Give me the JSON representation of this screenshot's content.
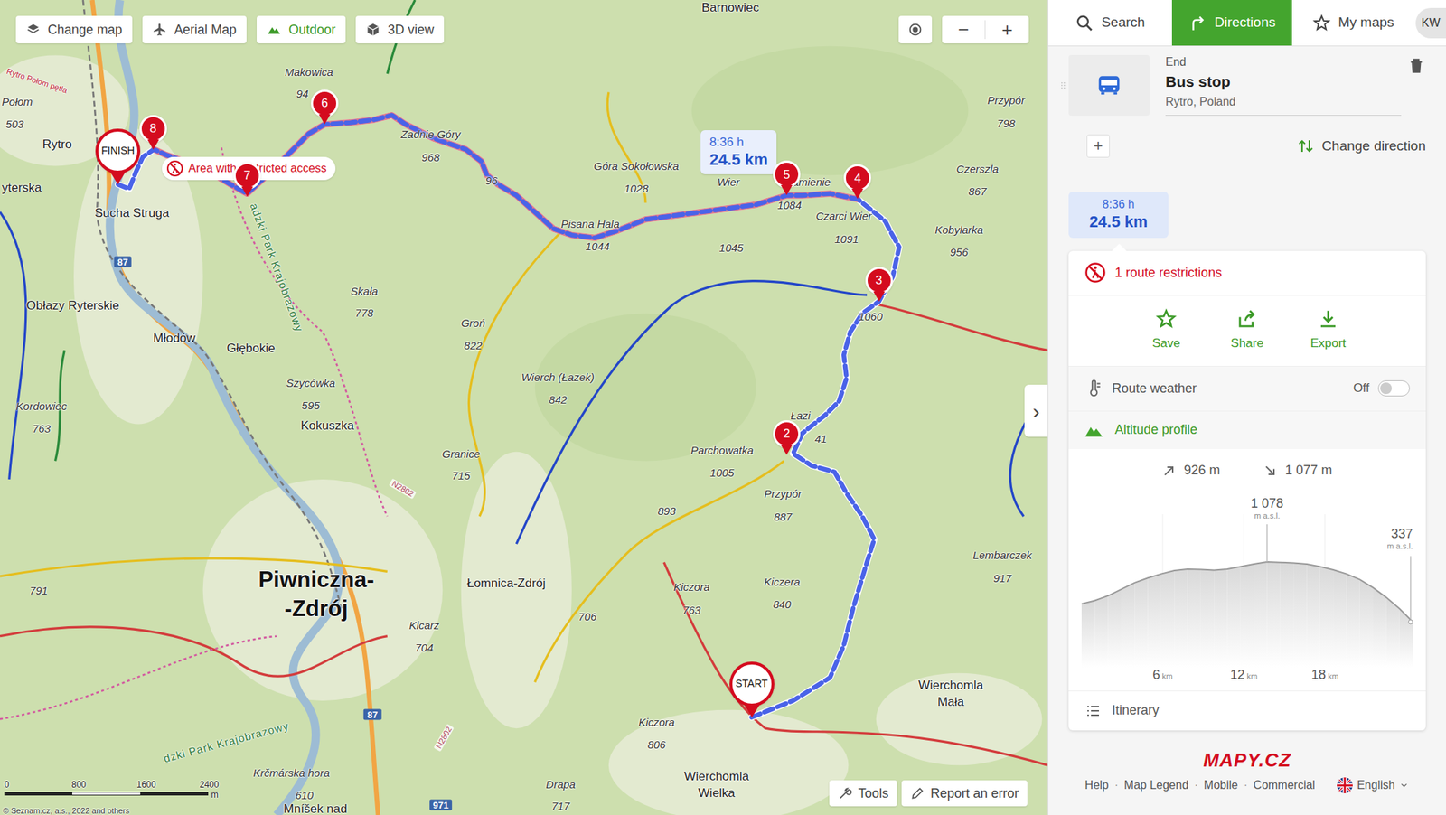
{
  "map": {
    "toolbar": [
      {
        "label": "Change map",
        "selected": false
      },
      {
        "label": "Aerial Map",
        "selected": false
      },
      {
        "label": "Outdoor",
        "selected": true
      },
      {
        "label": "3D view",
        "selected": false
      }
    ],
    "zoom": {
      "out": "−",
      "in": "+"
    },
    "labels": [
      {
        "text": "Barnowiec",
        "kind": "place"
      },
      {
        "text": "Rytro Połom pętla",
        "kind": "trail"
      },
      {
        "text": "Makowica",
        "kind": "peak"
      },
      {
        "text": "94",
        "kind": "elev"
      },
      {
        "text": "Połom",
        "kind": "peak"
      },
      {
        "text": "503",
        "kind": "elev"
      },
      {
        "text": "Rytro",
        "kind": "place"
      },
      {
        "text": "yterska",
        "kind": "place"
      },
      {
        "text": "Sucha Struga",
        "kind": "place"
      },
      {
        "text": "Zadnie Góry",
        "kind": "peak"
      },
      {
        "text": "968",
        "kind": "elev"
      },
      {
        "text": "96",
        "kind": "elev"
      },
      {
        "text": "Góra Sokołowska",
        "kind": "peak"
      },
      {
        "text": "1028",
        "kind": "elev"
      },
      {
        "text": "Pisana Hala",
        "kind": "peak"
      },
      {
        "text": "1044",
        "kind": "elev"
      },
      {
        "text": "1045",
        "kind": "elev"
      },
      {
        "text": "1084",
        "kind": "elev"
      },
      {
        "text": "Czarci Wier",
        "kind": "peak"
      },
      {
        "text": "1091",
        "kind": "elev"
      },
      {
        "text": "Przypór",
        "kind": "peak"
      },
      {
        "text": "798",
        "kind": "elev"
      },
      {
        "text": "Czerszla",
        "kind": "peak"
      },
      {
        "text": "867",
        "kind": "elev"
      },
      {
        "text": "Kobylarka",
        "kind": "peak"
      },
      {
        "text": "956",
        "kind": "elev"
      },
      {
        "text": "1060",
        "kind": "elev"
      },
      {
        "text": "Skała",
        "kind": "peak"
      },
      {
        "text": "778",
        "kind": "elev"
      },
      {
        "text": "Groń",
        "kind": "peak"
      },
      {
        "text": "822",
        "kind": "elev"
      },
      {
        "text": "Obłazy Ryterskie",
        "kind": "place"
      },
      {
        "text": "Młodów",
        "kind": "place"
      },
      {
        "text": "Głębokie",
        "kind": "place"
      },
      {
        "text": "Wierch (Łazek)",
        "kind": "peak"
      },
      {
        "text": "842",
        "kind": "elev"
      },
      {
        "text": "Szycówka",
        "kind": "peak"
      },
      {
        "text": "595",
        "kind": "elev"
      },
      {
        "text": "Kokuszka",
        "kind": "place"
      },
      {
        "text": "Kordowiec",
        "kind": "peak"
      },
      {
        "text": "763",
        "kind": "elev"
      },
      {
        "text": "Parchowatka",
        "kind": "peak"
      },
      {
        "text": "1005",
        "kind": "elev"
      },
      {
        "text": "Granice",
        "kind": "peak"
      },
      {
        "text": "715",
        "kind": "elev"
      },
      {
        "text": "Przypór",
        "kind": "peak"
      },
      {
        "text": "887",
        "kind": "elev"
      },
      {
        "text": "893",
        "kind": "elev"
      },
      {
        "text": "791",
        "kind": "elev"
      },
      {
        "text": "Piwniczna-",
        "kind": "town"
      },
      {
        "text": "-Zdrój",
        "kind": "town"
      },
      {
        "text": "Łomnica-Zdrój",
        "kind": "place"
      },
      {
        "text": "Lembarczek",
        "kind": "peak"
      },
      {
        "text": "917",
        "kind": "elev"
      },
      {
        "text": "Kiczora",
        "kind": "peak"
      },
      {
        "text": "763",
        "kind": "elev"
      },
      {
        "text": "Kiczera",
        "kind": "peak"
      },
      {
        "text": "840",
        "kind": "elev"
      },
      {
        "text": "706",
        "kind": "elev"
      },
      {
        "text": "Kicarz",
        "kind": "peak"
      },
      {
        "text": "704",
        "kind": "elev"
      },
      {
        "text": "Wierchomla",
        "kind": "place"
      },
      {
        "text": "Mała",
        "kind": "place"
      },
      {
        "text": "Kiczora",
        "kind": "peak"
      },
      {
        "text": "806",
        "kind": "elev"
      },
      {
        "text": "Wierchomla",
        "kind": "place"
      },
      {
        "text": "Wielka",
        "kind": "place"
      },
      {
        "text": "Krčmárska hora",
        "kind": "peak"
      },
      {
        "text": "610",
        "kind": "elev"
      },
      {
        "text": "Drapa",
        "kind": "peak"
      },
      {
        "text": "717",
        "kind": "elev"
      },
      {
        "text": "Mníšek nad",
        "kind": "place"
      },
      {
        "text": "Łazi",
        "kind": "peak"
      },
      {
        "text": "41",
        "kind": "elev"
      },
      {
        "text": "dzki Park Krajobrazowy",
        "kind": "park"
      },
      {
        "text": "adzki Park Krajobrazowy",
        "kind": "park"
      },
      {
        "text": "87",
        "kind": "road"
      },
      {
        "text": "87",
        "kind": "road"
      },
      {
        "text": "971",
        "kind": "road"
      },
      {
        "text": "N2802",
        "kind": "minor"
      },
      {
        "text": "N2802",
        "kind": "minor"
      },
      {
        "text": "Wier",
        "kind": "peak"
      },
      {
        "text": "amienie",
        "kind": "peak"
      }
    ],
    "markers": [
      {
        "label": "START",
        "kind": "end"
      },
      {
        "label": "2",
        "kind": "waypoint"
      },
      {
        "label": "3",
        "kind": "waypoint"
      },
      {
        "label": "4",
        "kind": "waypoint"
      },
      {
        "label": "5",
        "kind": "waypoint"
      },
      {
        "label": "6",
        "kind": "waypoint"
      },
      {
        "label": "7",
        "kind": "waypoint"
      },
      {
        "label": "8",
        "kind": "waypoint"
      },
      {
        "label": "FINISH",
        "kind": "end"
      }
    ],
    "restriction": "Area with restricted access",
    "route_tooltip": {
      "time": "8:36 h",
      "distance": "24.5 km"
    },
    "collapse": "›",
    "tools": [
      "Tools",
      "Report an error"
    ],
    "scale": [
      "0",
      "800",
      "1600",
      "2400",
      "m"
    ],
    "copyright": "© Seznam.cz, a.s., 2022 and others"
  },
  "sidebar": {
    "nav": [
      {
        "label": "Search",
        "selected": false
      },
      {
        "label": "Directions",
        "selected": true
      },
      {
        "label": "My maps",
        "selected": false
      }
    ],
    "avatar": "KW",
    "end": {
      "caption": "End",
      "name": "Bus stop",
      "place": "Rytro, Poland"
    },
    "add": "+",
    "change_direction": "Change direction",
    "summary": {
      "time": "8:36 h",
      "distance": "24.5 km"
    },
    "restrictions": "1 route restrictions",
    "actions": [
      "Save",
      "Share",
      "Export"
    ],
    "weather": {
      "label": "Route weather",
      "value": "Off",
      "on": false
    },
    "altitude": {
      "title": "Altitude profile",
      "ascent": "926 m",
      "descent": "1 077 m",
      "max": "1 078",
      "max_unit": "m a.s.l.",
      "end": "337",
      "end_unit": "m a.s.l.",
      "elevations": [
        560,
        600,
        660,
        740,
        820,
        880,
        930,
        970,
        990,
        985,
        975,
        990,
        1020,
        1050,
        1078,
        1072,
        1065,
        1050,
        1020,
        980,
        930,
        860,
        760,
        640,
        500,
        337
      ],
      "ticks": [
        {
          "value": "6",
          "unit": "km"
        },
        {
          "value": "12",
          "unit": "km"
        },
        {
          "value": "18",
          "unit": "km"
        }
      ]
    },
    "itinerary": "Itinerary",
    "logo": "MAPY.CZ",
    "links": [
      "Help",
      "Map Legend",
      "Mobile",
      "Commercial"
    ],
    "separator": "·",
    "language": "English"
  }
}
